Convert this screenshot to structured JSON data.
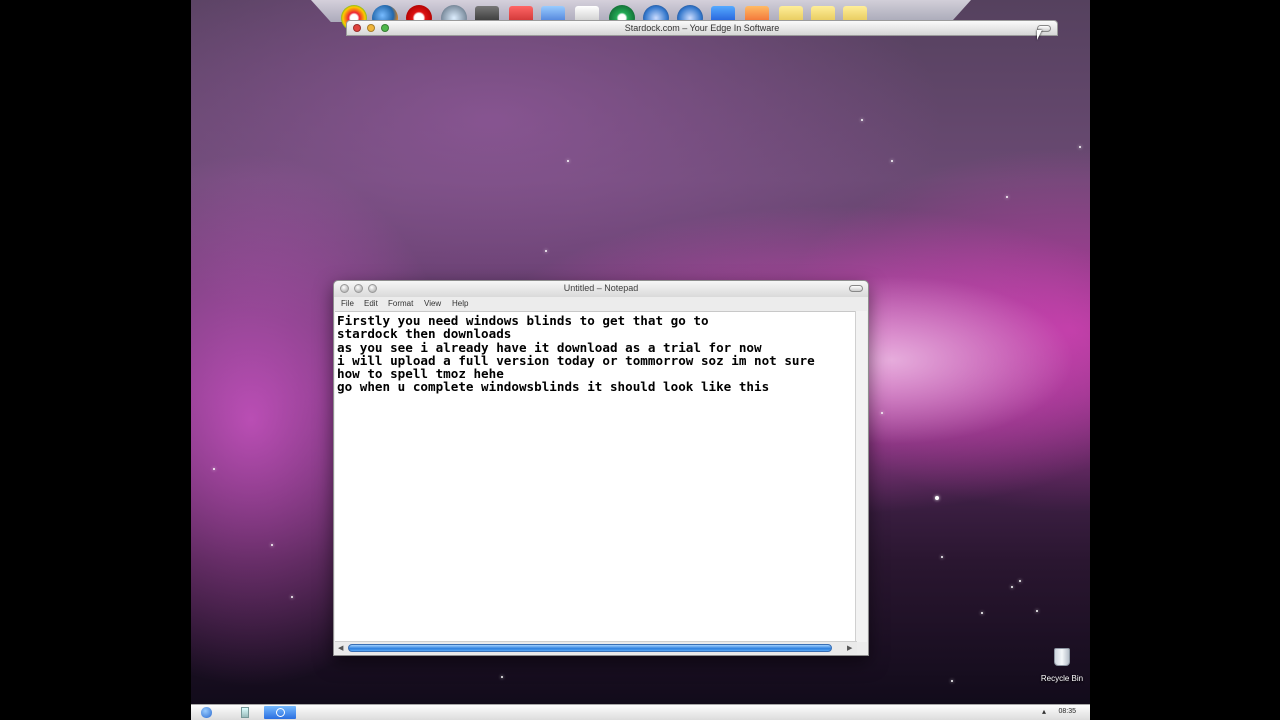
{
  "browser_window": {
    "title": "Stardock.com – Your Edge In Software"
  },
  "notepad": {
    "title": "Untitled – Notepad",
    "menu": [
      "File",
      "Edit",
      "Format",
      "View",
      "Help"
    ],
    "content": "Firstly you need windows blinds to get that go to\nstardock then downloads\nas you see i already have it download as a trial for now\ni will upload a full version today or tommorrow soz im not sure\nhow to spell tmoz hehe\ngo when u complete windowsblinds it should look like this"
  },
  "desktop": {
    "recycle_bin_label": "Recycle Bin"
  },
  "taskbar": {
    "clock": "08:35"
  },
  "colors": {
    "scroll_thumb": "#2d7fde",
    "close": "#e0443e",
    "minimize": "#f0b53a",
    "zoom": "#4fb74a"
  }
}
